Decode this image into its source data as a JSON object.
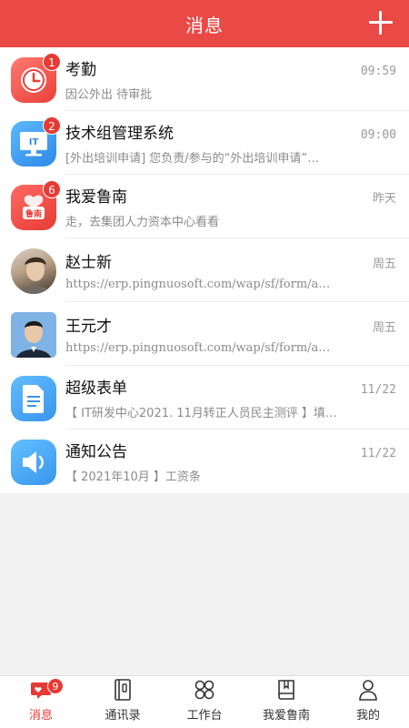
{
  "header": {
    "title": "消息",
    "add_icon": "plus-icon"
  },
  "messages": [
    {
      "name": "考勤",
      "time": "09:59",
      "preview": "因公外出 待审批",
      "badge": "1",
      "icon": "clock-icon"
    },
    {
      "name": "技术组管理系统",
      "time": "09:00",
      "preview": "[外出培训申请] 您负责/参与的“外出培训申请”…",
      "badge": "2",
      "icon": "it-monitor-icon",
      "icon_text": "IT"
    },
    {
      "name": "我爱鲁南",
      "time": "昨天",
      "preview": "走，去集团人力资本中心看看",
      "badge": "6",
      "icon": "lunan-icon",
      "icon_text": "鲁南"
    },
    {
      "name": "赵士新",
      "time": "周五",
      "preview": "https://erp.pingnuosoft.com/wap/sf/form/a…",
      "icon": "user-photo"
    },
    {
      "name": "王元才",
      "time": "周五",
      "preview": "https://erp.pingnuosoft.com/wap/sf/form/a…",
      "icon": "user-photo"
    },
    {
      "name": "超级表单",
      "time": "11/22",
      "preview": "【 IT研发中心2021. 11月转正人员民主测评 】填…",
      "icon": "document-icon"
    },
    {
      "name": "通知公告",
      "time": "11/22",
      "preview": "【 2021年10月 】工资条",
      "icon": "speaker-icon"
    }
  ],
  "tabbar": [
    {
      "label": "消息",
      "icon": "chat-bubble-icon",
      "badge": "9",
      "active": true
    },
    {
      "label": "通讯录",
      "icon": "contacts-book-icon"
    },
    {
      "label": "工作台",
      "icon": "grid-icon"
    },
    {
      "label": "我爱鲁南",
      "icon": "bookmark-book-icon"
    },
    {
      "label": "我的",
      "icon": "person-icon"
    }
  ],
  "colors": {
    "brand": "#e94a45",
    "badge": "#e63a34",
    "background": "#f2f2f2"
  }
}
